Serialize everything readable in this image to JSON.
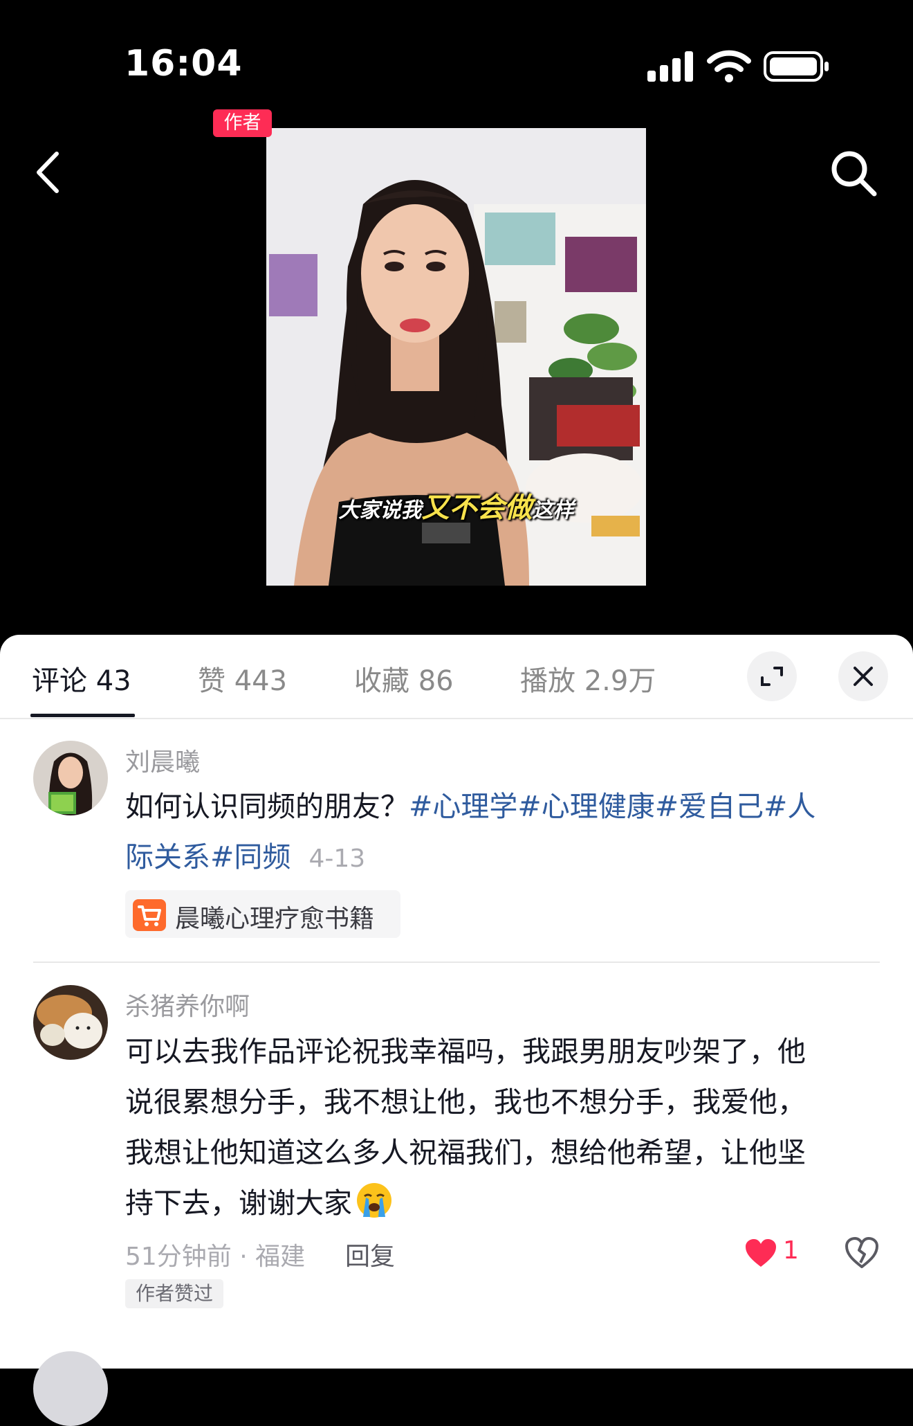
{
  "status_bar": {
    "time": "16:04"
  },
  "video": {
    "caption_plain_1": "大家说我",
    "caption_highlight": "又不会做",
    "caption_plain_2": "这样"
  },
  "tabs": [
    {
      "label": "评论 43"
    },
    {
      "label": "赞 443"
    },
    {
      "label": "收藏 86"
    },
    {
      "label": "播放 2.9万"
    }
  ],
  "post": {
    "author_name": "刘晨曦",
    "author_badge": "作者",
    "text": "如何认识同频的朋友？",
    "hashtags": "#心理学#心理健康#爱自己#人际关系#同频",
    "hashtags_line1": "#心理学#心理健康#爱自己#人",
    "hashtags_line2": "际关系#同频",
    "date": "4-13",
    "product_label": "晨曦心理疗愈书籍"
  },
  "comment": {
    "username": "杀猪养你啊",
    "lines": [
      "可以去我作品评论祝我幸福吗，我跟男朋友吵架了，他",
      "说很累想分手，我不想让他，我也不想分手，我爱他，",
      "我想让他知道这么多人祝福我们，想给他希望，让他坚",
      "持下去，谢谢大家"
    ],
    "emoji": "crying-face",
    "meta": "51分钟前 · 福建",
    "reply_label": "回复",
    "like_count": "1",
    "liked_tag": "作者赞过"
  },
  "colors": {
    "accent_red": "#fe2c55",
    "hashtag_blue": "#2f5b9e",
    "cart_orange": "#fe6a2c"
  },
  "icons": [
    "back-icon",
    "search-icon",
    "expand-icon",
    "close-icon",
    "heart-icon",
    "broken-heart-icon",
    "cart-icon",
    "signal-icon",
    "wifi-icon",
    "battery-icon"
  ]
}
